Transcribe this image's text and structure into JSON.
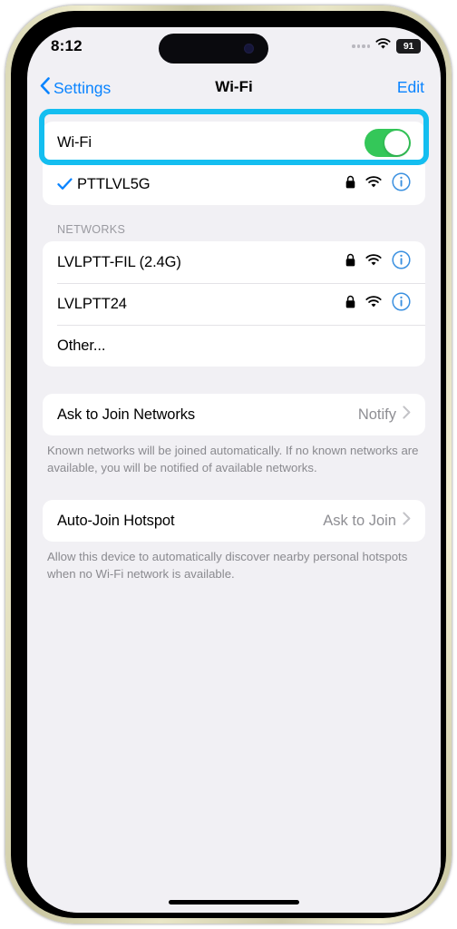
{
  "status_bar": {
    "time": "8:12",
    "battery_level": "91",
    "cellular_icon": "cellular-dots-icon",
    "wifi_icon": "wifi-icon",
    "battery_icon": "battery-pill-icon"
  },
  "nav_bar": {
    "back_label": "Settings",
    "back_icon": "chevron-left-icon",
    "title": "Wi-Fi",
    "edit_label": "Edit"
  },
  "wifi_section": {
    "toggle_label": "Wi-Fi",
    "toggle_on": true,
    "toggle_color": "#34C759",
    "highlight_color": "#14BEF0",
    "connected_network": {
      "name": "PTTLVL5G",
      "checked": true,
      "secured": true,
      "signal": "wifi-icon",
      "info": "info-circle-icon"
    }
  },
  "networks_section": {
    "header": "NETWORKS",
    "items": [
      {
        "name": "LVLPTT-FIL (2.4G)",
        "secured": true,
        "has_info": true
      },
      {
        "name": "LVLPTT24",
        "secured": true,
        "has_info": true
      },
      {
        "name": "Other...",
        "secured": false,
        "has_info": false
      }
    ]
  },
  "ask_to_join": {
    "label": "Ask to Join Networks",
    "value": "Notify",
    "footnote": "Known networks will be joined automatically. If no known networks are available, you will be notified of available networks."
  },
  "auto_join_hotspot": {
    "label": "Auto-Join Hotspot",
    "value": "Ask to Join",
    "footnote": "Allow this device to automatically discover nearby personal hotspots when no Wi-Fi network is available."
  },
  "accent_colors": {
    "ios_blue": "#0A84FF",
    "ios_green": "#34C759",
    "secondary_text": "#8E8E93",
    "background": "#F1F0F4"
  }
}
